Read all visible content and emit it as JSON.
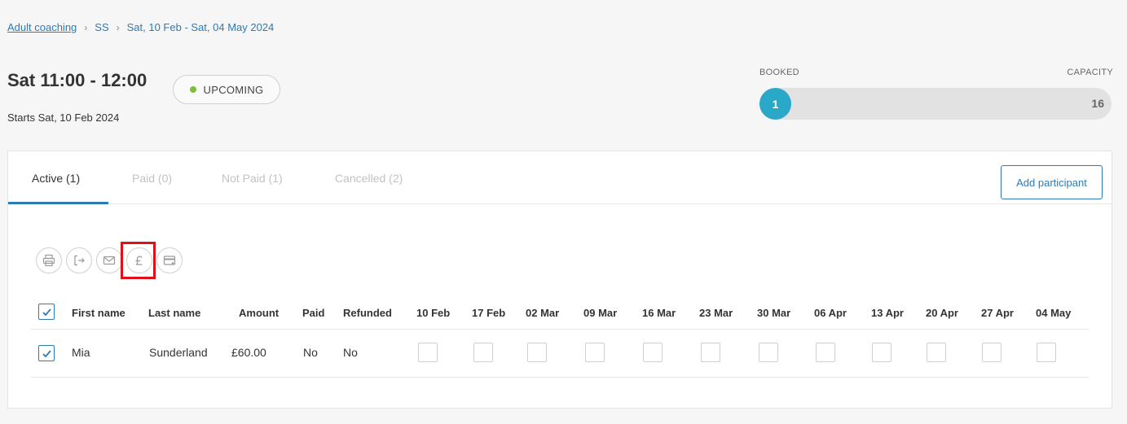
{
  "breadcrumb": {
    "root": "Adult coaching",
    "level2": "SS",
    "level3": "Sat, 10 Feb - Sat, 04 May 2024"
  },
  "session": {
    "title": "Sat 11:00 - 12:00",
    "starts": "Starts Sat, 10 Feb 2024",
    "status": "UPCOMING",
    "status_color": "#7cbf3a"
  },
  "capacity": {
    "booked_label": "BOOKED",
    "capacity_label": "CAPACITY",
    "booked": "1",
    "total": "16",
    "fill_fraction": 0.0625
  },
  "tabs": [
    {
      "label": "Active (1)"
    },
    {
      "label": "Paid (0)"
    },
    {
      "label": "Not Paid (1)"
    },
    {
      "label": "Cancelled (2)"
    }
  ],
  "add_participant_label": "Add participant",
  "toolbar_icons": [
    "print-icon",
    "export-icon",
    "email-icon",
    "pound-icon",
    "card-icon"
  ],
  "table": {
    "headers": {
      "first_name": "First name",
      "last_name": "Last name",
      "amount": "Amount",
      "paid": "Paid",
      "refunded": "Refunded"
    },
    "dates": [
      "10 Feb",
      "17 Feb",
      "02 Mar",
      "09 Mar",
      "16 Mar",
      "23 Mar",
      "30 Mar",
      "06 Apr",
      "13 Apr",
      "20 Apr",
      "27 Apr",
      "04 May"
    ],
    "rows": [
      {
        "first_name": "Mia",
        "last_name": "Sunderland",
        "amount": "£60.00",
        "paid": "No",
        "refunded": "No",
        "checked": true
      }
    ]
  },
  "colors": {
    "accent": "#2d7bb6",
    "capacity_fill": "#2aa8c8",
    "highlight": "#e0101a"
  }
}
